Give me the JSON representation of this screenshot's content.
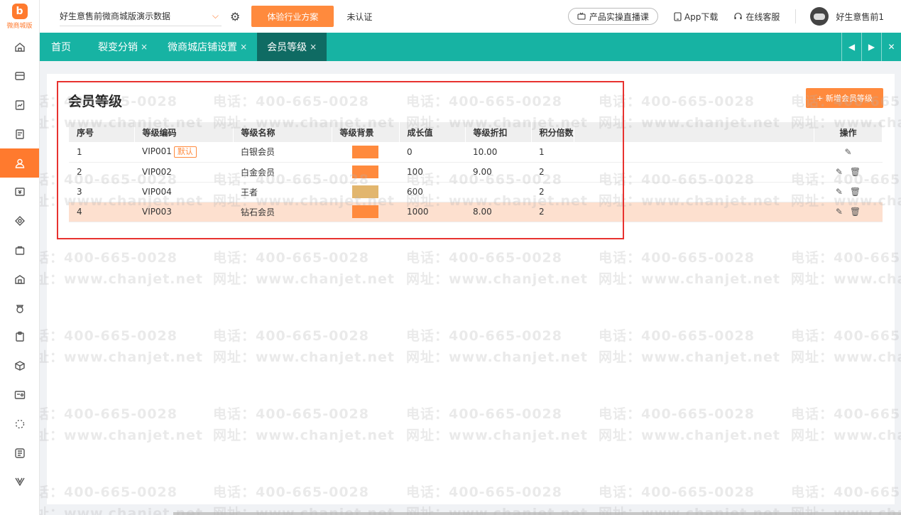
{
  "logo": {
    "mark": "b",
    "text": "微商城版"
  },
  "nav": [
    "home-icon",
    "store-icon",
    "report-icon",
    "document-icon",
    "member-icon",
    "coupon-icon",
    "marketing-icon",
    "bag-icon",
    "shop-icon",
    "money-icon",
    "clipboard-icon",
    "box-icon",
    "card-icon",
    "loading-icon",
    "news-icon",
    "v-icon"
  ],
  "topbar": {
    "store_name": "好生意售前微商城版演示数据",
    "chevron": "⌵",
    "gear": "⚙",
    "trial_label": "体验行业方案",
    "cert_status": "未认证",
    "live_label": "产品实操直播课",
    "app_label": "App下载",
    "service_label": "在线客服",
    "username": "好生意售前1"
  },
  "tabs": [
    {
      "label": "首页",
      "closable": false
    },
    {
      "label": "裂变分销",
      "closable": true
    },
    {
      "label": "微商城店铺设置",
      "closable": true
    },
    {
      "label": "会员等级",
      "closable": true,
      "active": true
    }
  ],
  "tab_close": "×",
  "tab_ctrls": {
    "prev": "◀",
    "next": "▶",
    "close": "✕"
  },
  "page": {
    "title": "会员等级",
    "add_button": "+ 新增会员等级"
  },
  "table": {
    "headers": [
      "序号",
      "等级编码",
      "等级名称",
      "等级背景",
      "成长值",
      "等级折扣",
      "积分倍数",
      "",
      "操作"
    ],
    "default_badge": "默认",
    "rows": [
      {
        "idx": "1",
        "code": "VIP001",
        "default": true,
        "name": "白银会员",
        "bg": "#ff8a3d",
        "growth": "0",
        "discount": "10.00",
        "points": "1",
        "ops": [
          "edit"
        ]
      },
      {
        "idx": "2",
        "code": "VIP002",
        "default": false,
        "name": "白金会员",
        "bg": "#ff8a3d",
        "growth": "100",
        "discount": "9.00",
        "points": "2",
        "ops": [
          "edit",
          "delete"
        ]
      },
      {
        "idx": "3",
        "code": "VIP004",
        "default": false,
        "name": "王者",
        "bg": "#e2b66e",
        "growth": "600",
        "discount": "",
        "points": "2",
        "ops": [
          "edit",
          "delete"
        ]
      },
      {
        "idx": "4",
        "code": "VIP003",
        "default": false,
        "name": "钻石会员",
        "bg": "#ff8a3d",
        "growth": "1000",
        "discount": "8.00",
        "points": "2",
        "ops": [
          "edit",
          "delete"
        ],
        "selected": true
      }
    ]
  },
  "op_icons": {
    "edit": "✎",
    "delete": "🗑"
  },
  "watermark": {
    "phone": "电话：400-665-0028",
    "site": "网址：www.chanjet.net"
  },
  "colors": {
    "accent": "#ff8a3d",
    "tabbar": "#17b3a3",
    "active_tab": "#0f6b63",
    "highlight": "#e8322f",
    "selected_row": "#fde0cf"
  }
}
